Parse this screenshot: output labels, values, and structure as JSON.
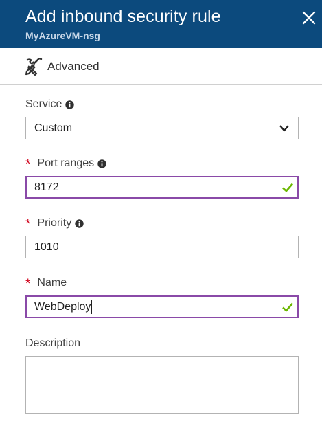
{
  "header": {
    "title": "Add inbound security rule",
    "subtitle": "MyAzureVM-nsg"
  },
  "toolbar": {
    "advanced_label": "Advanced"
  },
  "fields": {
    "service": {
      "label": "Service",
      "value": "Custom",
      "required": false
    },
    "port_ranges": {
      "label": "Port ranges",
      "value": "8172",
      "required": true
    },
    "priority": {
      "label": "Priority",
      "value": "1010",
      "required": true
    },
    "name": {
      "label": "Name",
      "value": "WebDeploy",
      "required": true
    },
    "description": {
      "label": "Description",
      "value": ""
    }
  },
  "required_marker": "*",
  "colors": {
    "header_bg": "#0c4a7d",
    "valid_border": "#8a4aa8",
    "check": "#6bb700",
    "required": "#d0021b"
  },
  "icons": {
    "close": "close-icon",
    "advanced": "tools-icon",
    "info": "info-icon",
    "check": "check-icon",
    "dropdown": "chevron-down-icon"
  }
}
